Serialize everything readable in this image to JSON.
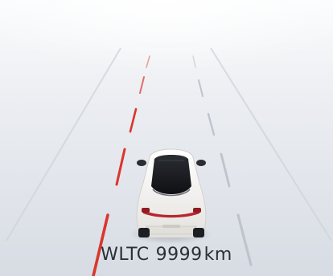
{
  "range": {
    "standard": "WLTC",
    "value": "9999",
    "unit": "km"
  },
  "colors": {
    "lane_warning": "#d9362d",
    "lane_marking": "#c3c8d1",
    "road_top": "#f2f4f7",
    "road_bottom": "#d6dbe3",
    "car_body": "#f4f3f0",
    "car_roof": "#1b1d21",
    "tail_light": "#b8262e"
  },
  "icons": [
    "vehicle-icon"
  ]
}
